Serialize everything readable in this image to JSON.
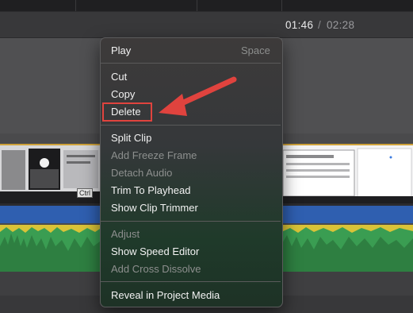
{
  "timecode": {
    "current": "01:46",
    "separator": "/",
    "total": "02:28"
  },
  "context_menu": {
    "items": [
      {
        "label": "Play",
        "shortcut": "Space",
        "enabled": true
      },
      {
        "label": "Cut",
        "enabled": true
      },
      {
        "label": "Copy",
        "enabled": true
      },
      {
        "label": "Delete",
        "enabled": true,
        "highlighted": true
      },
      {
        "label": "Split Clip",
        "enabled": true
      },
      {
        "label": "Add Freeze Frame",
        "enabled": false
      },
      {
        "label": "Detach Audio",
        "enabled": false
      },
      {
        "label": "Trim To Playhead",
        "enabled": true
      },
      {
        "label": "Show Clip Trimmer",
        "enabled": true
      },
      {
        "label": "Adjust",
        "enabled": false
      },
      {
        "label": "Show Speed Editor",
        "enabled": true
      },
      {
        "label": "Add Cross Dissolve",
        "enabled": false
      },
      {
        "label": "Reveal in Project Media",
        "enabled": true
      }
    ]
  },
  "thumbnail": {
    "label": "Ctrl"
  },
  "colors": {
    "highlight_box": "#e0433e",
    "arrow": "#e0433e",
    "audio_waveform": "#3a9d52",
    "audio_peaks": "#d9c338",
    "video_track": "#2f5fb0"
  },
  "icons": {
    "annotation_arrow": "arrow-icon"
  }
}
